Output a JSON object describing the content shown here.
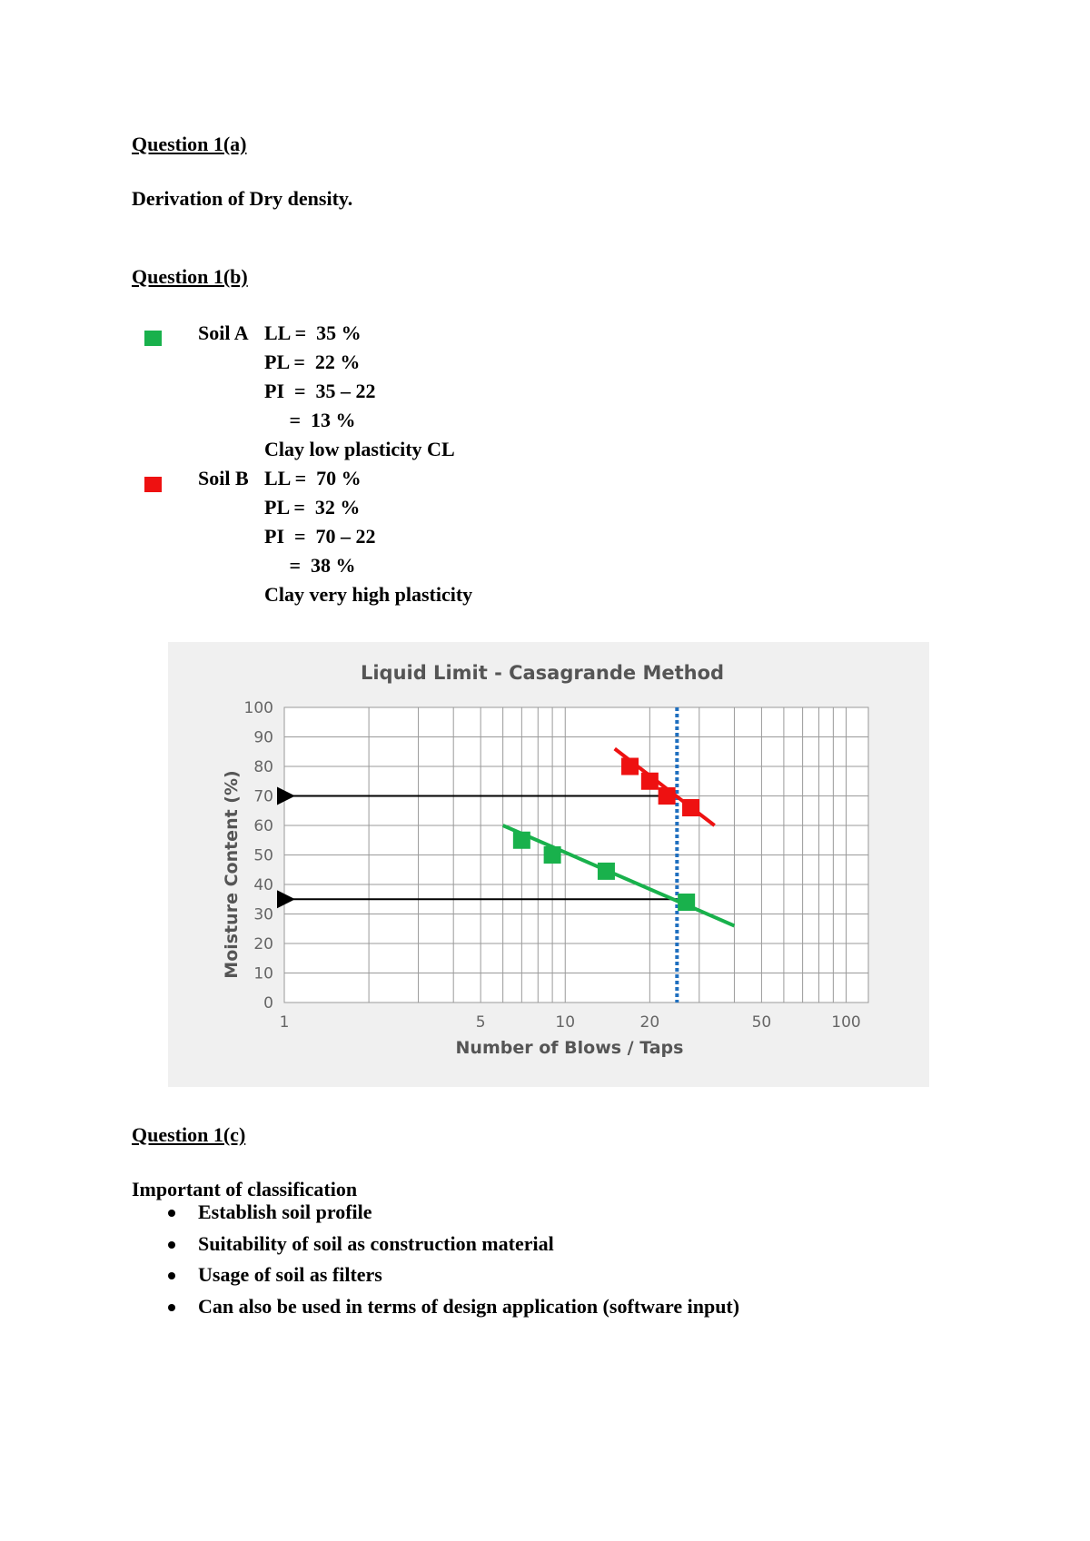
{
  "sections": {
    "q1a": {
      "heading": "Question 1(a)",
      "text": "Derivation of Dry density."
    },
    "q1b": {
      "heading": "Question 1(b)",
      "soils": [
        {
          "name": "Soil A",
          "color": "#19b14c",
          "lines": [
            "LL =  35 %",
            "PL =  22 %",
            "PI  =  35 – 22",
            "     =  13 %"
          ],
          "classification": "Clay low plasticity CL"
        },
        {
          "name": "Soil B",
          "color": "#ee1111",
          "lines": [
            "LL =  70 %",
            "PL =  32 %",
            "PI  =  70 – 22",
            "     =  38 %"
          ],
          "classification": "Clay very high plasticity"
        }
      ]
    },
    "q1c": {
      "heading": "Question 1(c)",
      "intro": "Important of classification",
      "bullets": [
        "Establish soil profile",
        "Suitability of soil as construction material",
        "Usage of soil as filters",
        "Can also be used in terms of design application (software input)"
      ]
    }
  },
  "chart_data": {
    "type": "scatter",
    "title": "Liquid Limit - Casagrande Method",
    "xlabel": "Number of Blows / Taps",
    "ylabel": "Moisture Content (%)",
    "xscale": "log",
    "xlim": [
      1,
      120
    ],
    "ylim": [
      0,
      100
    ],
    "x_ticks": [
      1,
      5,
      10,
      20,
      50,
      100
    ],
    "y_ticks": [
      0,
      10,
      20,
      30,
      40,
      50,
      60,
      70,
      80,
      90,
      100
    ],
    "grid": true,
    "series": [
      {
        "name": "Soil B",
        "color": "#ee1111",
        "points": [
          [
            17,
            80
          ],
          [
            20,
            75
          ],
          [
            23,
            70
          ],
          [
            28,
            66
          ]
        ],
        "trend_line": [
          [
            15,
            86
          ],
          [
            34,
            60
          ]
        ]
      },
      {
        "name": "Soil A",
        "color": "#19b14c",
        "points": [
          [
            7,
            55
          ],
          [
            9,
            50
          ],
          [
            14,
            44.5
          ],
          [
            27,
            34
          ]
        ],
        "trend_line": [
          [
            6,
            60
          ],
          [
            40,
            26
          ]
        ]
      }
    ],
    "reference_line": {
      "x": 25,
      "color": "#1f6fbf",
      "style": "dotted"
    },
    "arrows": [
      {
        "from_x": 25,
        "y": 70,
        "to_x": 1
      },
      {
        "from_x": 25,
        "y": 35,
        "to_x": 1
      }
    ]
  }
}
